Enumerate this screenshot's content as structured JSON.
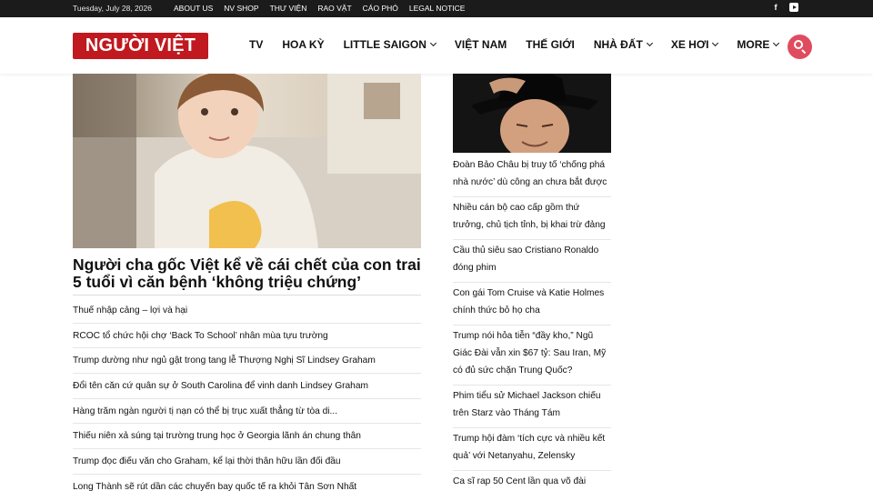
{
  "topbar": {
    "date": "Tuesday, July 28, 2026",
    "links": [
      "ABOUT US",
      "NV SHOP",
      "THƯ VIỆN",
      "RAO VẶT",
      "CÁO PHÓ",
      "LEGAL NOTICE"
    ],
    "social": [
      {
        "name": "facebook-icon",
        "glyph": "f"
      },
      {
        "name": "youtube-icon",
        "glyph": ""
      }
    ]
  },
  "header": {
    "logo": "NGƯỜI VIỆT",
    "logo_color": "#c0191f",
    "nav": [
      {
        "label": "TV",
        "dropdown": false
      },
      {
        "label": "HOA KỲ",
        "dropdown": false
      },
      {
        "label": "LITTLE SAIGON",
        "dropdown": true
      },
      {
        "label": "VIỆT NAM",
        "dropdown": false
      },
      {
        "label": "THẾ GIỚI",
        "dropdown": false
      },
      {
        "label": "NHÀ ĐẤT",
        "dropdown": true
      },
      {
        "label": "XE HƠI",
        "dropdown": true
      },
      {
        "label": "MORE",
        "dropdown": true
      }
    ],
    "search_color": "#e04c5f"
  },
  "main": {
    "headline": "Người cha gốc Việt kể về cái chết của con trai 5 tuổi vì căn bệnh ‘không triệu chứng’",
    "articles": [
      "Thuế nhập cảng – lợi và hại",
      "RCOC tổ chức hội chợ ‘Back To School’ nhân mùa tựu trường",
      "Trump dường như ngủ gật trong tang lễ Thượng Nghị Sĩ Lindsey Graham",
      "Đổi tên căn cứ quân sự ở South Carolina để vinh danh Lindsey Graham",
      "Hàng trăm ngàn người tị nạn có thể bị trục xuất thẳng từ tòa di...",
      "Thiếu niên xả súng tại trường trung học ở Georgia lãnh án chung thân",
      "Trump đọc điếu văn cho Graham, kể lại thời thân hữu lần đối đầu",
      "Long Thành sẽ rút dần các chuyến bay quốc tế ra khỏi Tân Sơn Nhất"
    ]
  },
  "side": {
    "articles": [
      "Đoàn Bảo Châu bị truy tố ‘chống phá nhà nước’ dù công an chưa bắt được",
      "Nhiều cán bộ cao cấp gồm thứ trưởng, chủ tịch tỉnh, bị khai trừ đảng",
      "Cầu thủ siêu sao Cristiano Ronaldo đóng phim",
      "Con gái Tom Cruise và Katie Holmes chính thức bỏ họ cha",
      "Trump nói hỏa tiễn “đầy kho,” Ngũ Giác Đài vẫn xin $67 tỷ: Sau Iran, Mỹ có đủ sức chặn Trung Quốc?",
      "Phim tiểu sử Michael Jackson chiếu trên Starz vào Tháng Tám",
      "Trump hội đàm ‘tích cực và nhiều kết quả’ với Netanyahu, Zelensky",
      "Ca sĩ rap 50 Cent lần qua võ đài"
    ]
  }
}
